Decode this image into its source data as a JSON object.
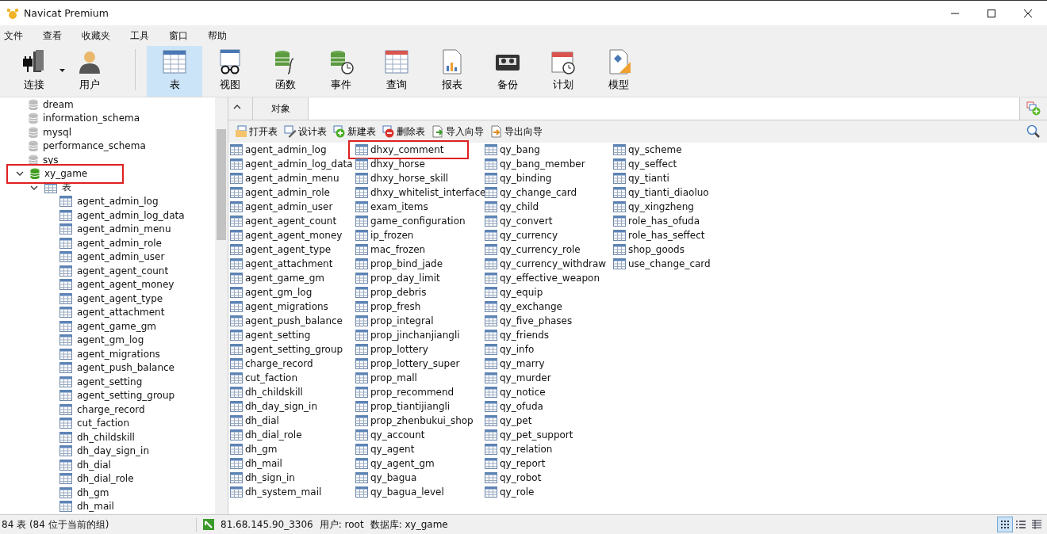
{
  "window": {
    "title": "Navicat Premium"
  },
  "menu": [
    "文件",
    "查看",
    "收藏夹",
    "工具",
    "窗口",
    "帮助"
  ],
  "toolbar": [
    {
      "label": "连接",
      "selected": false
    },
    {
      "label": "用户",
      "selected": false
    },
    {
      "label": "表",
      "selected": true
    },
    {
      "label": "视图",
      "selected": false
    },
    {
      "label": "函数",
      "selected": false
    },
    {
      "label": "事件",
      "selected": false
    },
    {
      "label": "查询",
      "selected": false
    },
    {
      "label": "报表",
      "selected": false
    },
    {
      "label": "备份",
      "selected": false
    },
    {
      "label": "计划",
      "selected": false
    },
    {
      "label": "模型",
      "selected": false
    }
  ],
  "sidebar": {
    "databases": [
      {
        "name": "dream",
        "active": false,
        "highlighted": false
      },
      {
        "name": "information_schema",
        "active": false,
        "highlighted": false
      },
      {
        "name": "mysql",
        "active": false,
        "highlighted": false
      },
      {
        "name": "performance_schema",
        "active": false,
        "highlighted": false
      },
      {
        "name": "sys",
        "active": false,
        "highlighted": false
      },
      {
        "name": "xy_game",
        "active": true,
        "highlighted": true,
        "expanded": true,
        "children": [
          {
            "name": "表",
            "expanded": true,
            "children": [
              "agent_admin_log",
              "agent_admin_log_data",
              "agent_admin_menu",
              "agent_admin_role",
              "agent_admin_user",
              "agent_agent_count",
              "agent_agent_money",
              "agent_agent_type",
              "agent_attachment",
              "agent_game_gm",
              "agent_gm_log",
              "agent_migrations",
              "agent_push_balance",
              "agent_setting",
              "agent_setting_group",
              "charge_record",
              "cut_faction",
              "dh_childskill",
              "dh_day_sign_in",
              "dh_dial",
              "dh_dial_role",
              "dh_gm",
              "dh_mail"
            ]
          }
        ]
      }
    ]
  },
  "tabs": [
    {
      "label": "对象",
      "selected": true
    }
  ],
  "object_toolbar": [
    "打开表",
    "设计表",
    "新建表",
    "删除表",
    "导入向导",
    "导出向导"
  ],
  "tables": [
    [
      {
        "name": "agent_admin_log",
        "highlighted": false
      },
      {
        "name": "agent_admin_log_data",
        "highlighted": false
      },
      {
        "name": "agent_admin_menu",
        "highlighted": false
      },
      {
        "name": "agent_admin_role",
        "highlighted": false
      },
      {
        "name": "agent_admin_user",
        "highlighted": false
      },
      {
        "name": "agent_agent_count",
        "highlighted": false
      },
      {
        "name": "agent_agent_money",
        "highlighted": false
      },
      {
        "name": "agent_agent_type",
        "highlighted": false
      },
      {
        "name": "agent_attachment",
        "highlighted": false
      },
      {
        "name": "agent_game_gm",
        "highlighted": false
      },
      {
        "name": "agent_gm_log",
        "highlighted": false
      },
      {
        "name": "agent_migrations",
        "highlighted": false
      },
      {
        "name": "agent_push_balance",
        "highlighted": false
      },
      {
        "name": "agent_setting",
        "highlighted": false
      },
      {
        "name": "agent_setting_group",
        "highlighted": false
      },
      {
        "name": "charge_record",
        "highlighted": false
      },
      {
        "name": "cut_faction",
        "highlighted": false
      },
      {
        "name": "dh_childskill",
        "highlighted": false
      },
      {
        "name": "dh_day_sign_in",
        "highlighted": false
      },
      {
        "name": "dh_dial",
        "highlighted": false
      },
      {
        "name": "dh_dial_role",
        "highlighted": false
      },
      {
        "name": "dh_gm",
        "highlighted": false
      },
      {
        "name": "dh_mail",
        "highlighted": false
      },
      {
        "name": "dh_sign_in",
        "highlighted": false
      },
      {
        "name": "dh_system_mail",
        "highlighted": false
      }
    ],
    [
      {
        "name": "dhxy_comment",
        "highlighted": true
      },
      {
        "name": "dhxy_horse",
        "highlighted": false
      },
      {
        "name": "dhxy_horse_skill",
        "highlighted": false
      },
      {
        "name": "dhxy_whitelist_interface",
        "highlighted": false
      },
      {
        "name": "exam_items",
        "highlighted": false
      },
      {
        "name": "game_configuration",
        "highlighted": false
      },
      {
        "name": "ip_frozen",
        "highlighted": false
      },
      {
        "name": "mac_frozen",
        "highlighted": false
      },
      {
        "name": "prop_bind_jade",
        "highlighted": false
      },
      {
        "name": "prop_day_limit",
        "highlighted": false
      },
      {
        "name": "prop_debris",
        "highlighted": false
      },
      {
        "name": "prop_fresh",
        "highlighted": false
      },
      {
        "name": "prop_integral",
        "highlighted": false
      },
      {
        "name": "prop_jinchanjiangli",
        "highlighted": false
      },
      {
        "name": "prop_lottery",
        "highlighted": false
      },
      {
        "name": "prop_lottery_super",
        "highlighted": false
      },
      {
        "name": "prop_mall",
        "highlighted": false
      },
      {
        "name": "prop_recommend",
        "highlighted": false
      },
      {
        "name": "prop_tiantijiangli",
        "highlighted": false
      },
      {
        "name": "prop_zhenbukui_shop",
        "highlighted": false
      },
      {
        "name": "qy_account",
        "highlighted": false
      },
      {
        "name": "qy_agent",
        "highlighted": false
      },
      {
        "name": "qy_agent_gm",
        "highlighted": false
      },
      {
        "name": "qy_bagua",
        "highlighted": false
      },
      {
        "name": "qy_bagua_level",
        "highlighted": false
      }
    ],
    [
      {
        "name": "qy_bang",
        "highlighted": false
      },
      {
        "name": "qy_bang_member",
        "highlighted": false
      },
      {
        "name": "qy_binding",
        "highlighted": false
      },
      {
        "name": "qy_change_card",
        "highlighted": false
      },
      {
        "name": "qy_child",
        "highlighted": false
      },
      {
        "name": "qy_convert",
        "highlighted": false
      },
      {
        "name": "qy_currency",
        "highlighted": false
      },
      {
        "name": "qy_currency_role",
        "highlighted": false
      },
      {
        "name": "qy_currency_withdraw",
        "highlighted": false
      },
      {
        "name": "qy_effective_weapon",
        "highlighted": false
      },
      {
        "name": "qy_equip",
        "highlighted": false
      },
      {
        "name": "qy_exchange",
        "highlighted": false
      },
      {
        "name": "qy_five_phases",
        "highlighted": false
      },
      {
        "name": "qy_friends",
        "highlighted": false
      },
      {
        "name": "qy_info",
        "highlighted": false
      },
      {
        "name": "qy_marry",
        "highlighted": false
      },
      {
        "name": "qy_murder",
        "highlighted": false
      },
      {
        "name": "qy_notice",
        "highlighted": false
      },
      {
        "name": "qy_ofuda",
        "highlighted": false
      },
      {
        "name": "qy_pet",
        "highlighted": false
      },
      {
        "name": "qy_pet_support",
        "highlighted": false
      },
      {
        "name": "qy_relation",
        "highlighted": false
      },
      {
        "name": "qy_report",
        "highlighted": false
      },
      {
        "name": "qy_robot",
        "highlighted": false
      },
      {
        "name": "qy_role",
        "highlighted": false
      }
    ],
    [
      {
        "name": "qy_scheme",
        "highlighted": false
      },
      {
        "name": "qy_seffect",
        "highlighted": false
      },
      {
        "name": "qy_tianti",
        "highlighted": false
      },
      {
        "name": "qy_tianti_diaoluo",
        "highlighted": false
      },
      {
        "name": "qy_xingzheng",
        "highlighted": false
      },
      {
        "name": "role_has_ofuda",
        "highlighted": false
      },
      {
        "name": "role_has_seffect",
        "highlighted": false
      },
      {
        "name": "shop_goods",
        "highlighted": false
      },
      {
        "name": "use_change_card",
        "highlighted": false
      }
    ]
  ],
  "status_bar": {
    "count": "84 表 (84 位于当前的组)",
    "connection": "81.68.145.90_3306",
    "user": "用户: root",
    "database": "数据库: xy_game",
    "views": [
      {
        "selected": true
      },
      {
        "selected": false
      },
      {
        "selected": false
      }
    ]
  }
}
